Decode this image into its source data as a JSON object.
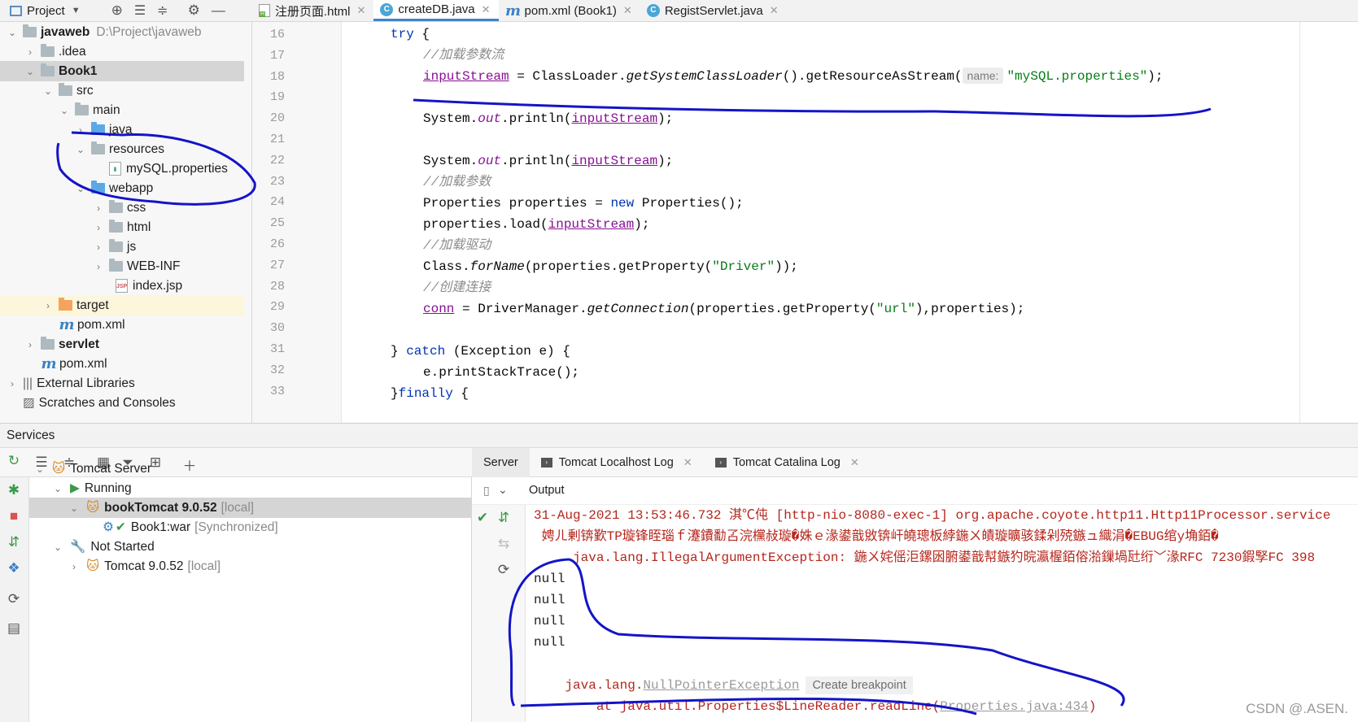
{
  "project_panel": {
    "title": "Project",
    "tree": [
      {
        "label": "javaweb",
        "path": "D:\\Project\\javaweb"
      },
      {
        "label": ".idea"
      },
      {
        "label": "Book1"
      },
      {
        "label": "src"
      },
      {
        "label": "main"
      },
      {
        "label": "java"
      },
      {
        "label": "resources"
      },
      {
        "label": "mySQL.properties"
      },
      {
        "label": "webapp"
      },
      {
        "label": "css"
      },
      {
        "label": "html"
      },
      {
        "label": "js"
      },
      {
        "label": "WEB-INF"
      },
      {
        "label": "index.jsp"
      },
      {
        "label": "target"
      },
      {
        "label": "pom.xml"
      },
      {
        "label": "servlet"
      },
      {
        "label": "pom.xml"
      },
      {
        "label": "External Libraries"
      },
      {
        "label": "Scratches and Consoles"
      }
    ]
  },
  "editor": {
    "tabs": [
      {
        "label": "注册页面.html"
      },
      {
        "label": "createDB.java"
      },
      {
        "label": "pom.xml (Book1)"
      },
      {
        "label": "RegistServlet.java"
      }
    ],
    "line_numbers": [
      "16",
      "17",
      "18",
      "19",
      "20",
      "21",
      "22",
      "23",
      "24",
      "25",
      "26",
      "27",
      "28",
      "29",
      "30",
      "31",
      "32",
      "33"
    ],
    "param_hint": "name:",
    "code": {
      "l16_kw": "try",
      "l16_rest": " {",
      "l17": "//加载参数流",
      "l18_a": "inputStream",
      "l18_b": " = ClassLoader.",
      "l18_c": "getSystemClassLoader",
      "l18_d": "().getResourceAsStream(",
      "l18_str": "\"mySQL.properties\"",
      "l18_e": ");",
      "l20_a": "System.",
      "l20_out": "out",
      "l20_b": ".println(",
      "l20_var": "inputStream",
      "l20_c": ");",
      "l23": "//加载参数",
      "l24_a": "Properties properties = ",
      "l24_new": "new",
      "l24_b": " Properties();",
      "l25_a": "properties.load(",
      "l25_var": "inputStream",
      "l25_b": ");",
      "l26": "//加载驱动",
      "l27_a": "Class.",
      "l27_fn": "forName",
      "l27_b": "(properties.getProperty(",
      "l27_str": "\"Driver\"",
      "l27_c": "));",
      "l28": "//创建连接",
      "l29_var": "conn",
      "l29_a": " = DriverManager.",
      "l29_fn": "getConnection",
      "l29_b": "(properties.getProperty(",
      "l29_str": "\"url\"",
      "l29_c": "),properties);",
      "l31_a": "} ",
      "l31_kw": "catch",
      "l31_b": " (Exception e) {",
      "l32": "e.printStackTrace();",
      "l33_a": "}",
      "l33_kw": "finally",
      "l33_b": " {"
    }
  },
  "services": {
    "title": "Services",
    "tree": [
      {
        "label": "Tomcat Server"
      },
      {
        "label": "Running"
      },
      {
        "label": "bookTomcat 9.0.52",
        "suffix": "[local]"
      },
      {
        "label": "Book1:war",
        "suffix": "[Synchronized]"
      },
      {
        "label": "Not Started"
      },
      {
        "label": "Tomcat 9.0.52",
        "suffix": "[local]"
      }
    ],
    "output_tabs": [
      {
        "label": "Server"
      },
      {
        "label": "Tomcat Localhost Log"
      },
      {
        "label": "Tomcat Catalina Log"
      }
    ],
    "output_label": "Output",
    "output_lines": [
      "31-Aug-2021 13:53:46.732 淇℃伅 [http-nio-8080-exec-1] org.apache.coyote.http11.Http11Processor.service",
      " 娉ㄦ剰锛歏TP璇锋眰瑙ｆ瀽鐨勫叾浣欓敊璇�姝ｅ湪鍙戠敓锛屽皢璁板綍鍦ㄨ皟璇曠骇鍒剁殑鏃ュ織涓�EBUG绾у埆銆�",
      "     java.lang.IllegalArgumentException: 鍦ㄨ姹傜洰鏍囦腑鍙戠幇鏃犳晥瀛楃銆傛湁鏁堝瓧绗﹀湪RFC 7230鍜孯FC 398",
      "null",
      "null",
      "null",
      "null"
    ],
    "npe_prefix": "java.lang.",
    "npe_link": "NullPointerException",
    "breakpoint_btn": "Create breakpoint",
    "stack_prefix": "    at java.util.Properties$LineReader.readLine(",
    "stack_link": "Properties.java:434",
    "stack_suffix": ")"
  },
  "watermark": "CSDN @.ASEN."
}
